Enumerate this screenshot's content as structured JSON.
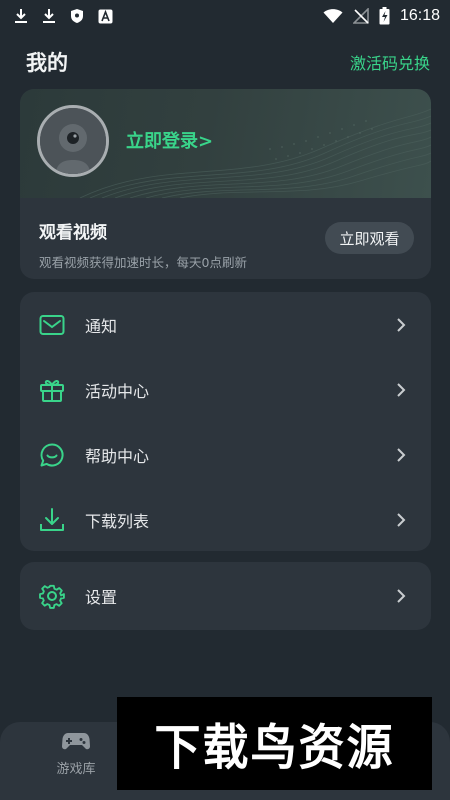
{
  "status_bar": {
    "time": "16:18",
    "icons": [
      "download-icon",
      "download-icon",
      "shield-icon",
      "font-icon",
      "wifi-icon",
      "no-signal-icon",
      "battery-charging-icon"
    ]
  },
  "header": {
    "title": "我的",
    "redeem_label": "激活码兑换"
  },
  "profile": {
    "login_label": "立即登录>",
    "video_title": "观看视频",
    "video_desc": "观看视频获得加速时长，每天0点刷新",
    "watch_button": "立即观看"
  },
  "menu": {
    "items": [
      {
        "label": "通知",
        "icon": "mail-icon"
      },
      {
        "label": "活动中心",
        "icon": "gift-icon"
      },
      {
        "label": "帮助中心",
        "icon": "chat-icon"
      },
      {
        "label": "下载列表",
        "icon": "download-icon"
      }
    ],
    "settings": {
      "label": "设置",
      "icon": "gear-icon"
    }
  },
  "bottom_nav": {
    "games_label": "游戏库"
  },
  "watermark": {
    "text": "下载鸟资源"
  },
  "colors": {
    "accent": "#39d48a",
    "background": "#222a31",
    "card": "#2d353d"
  }
}
